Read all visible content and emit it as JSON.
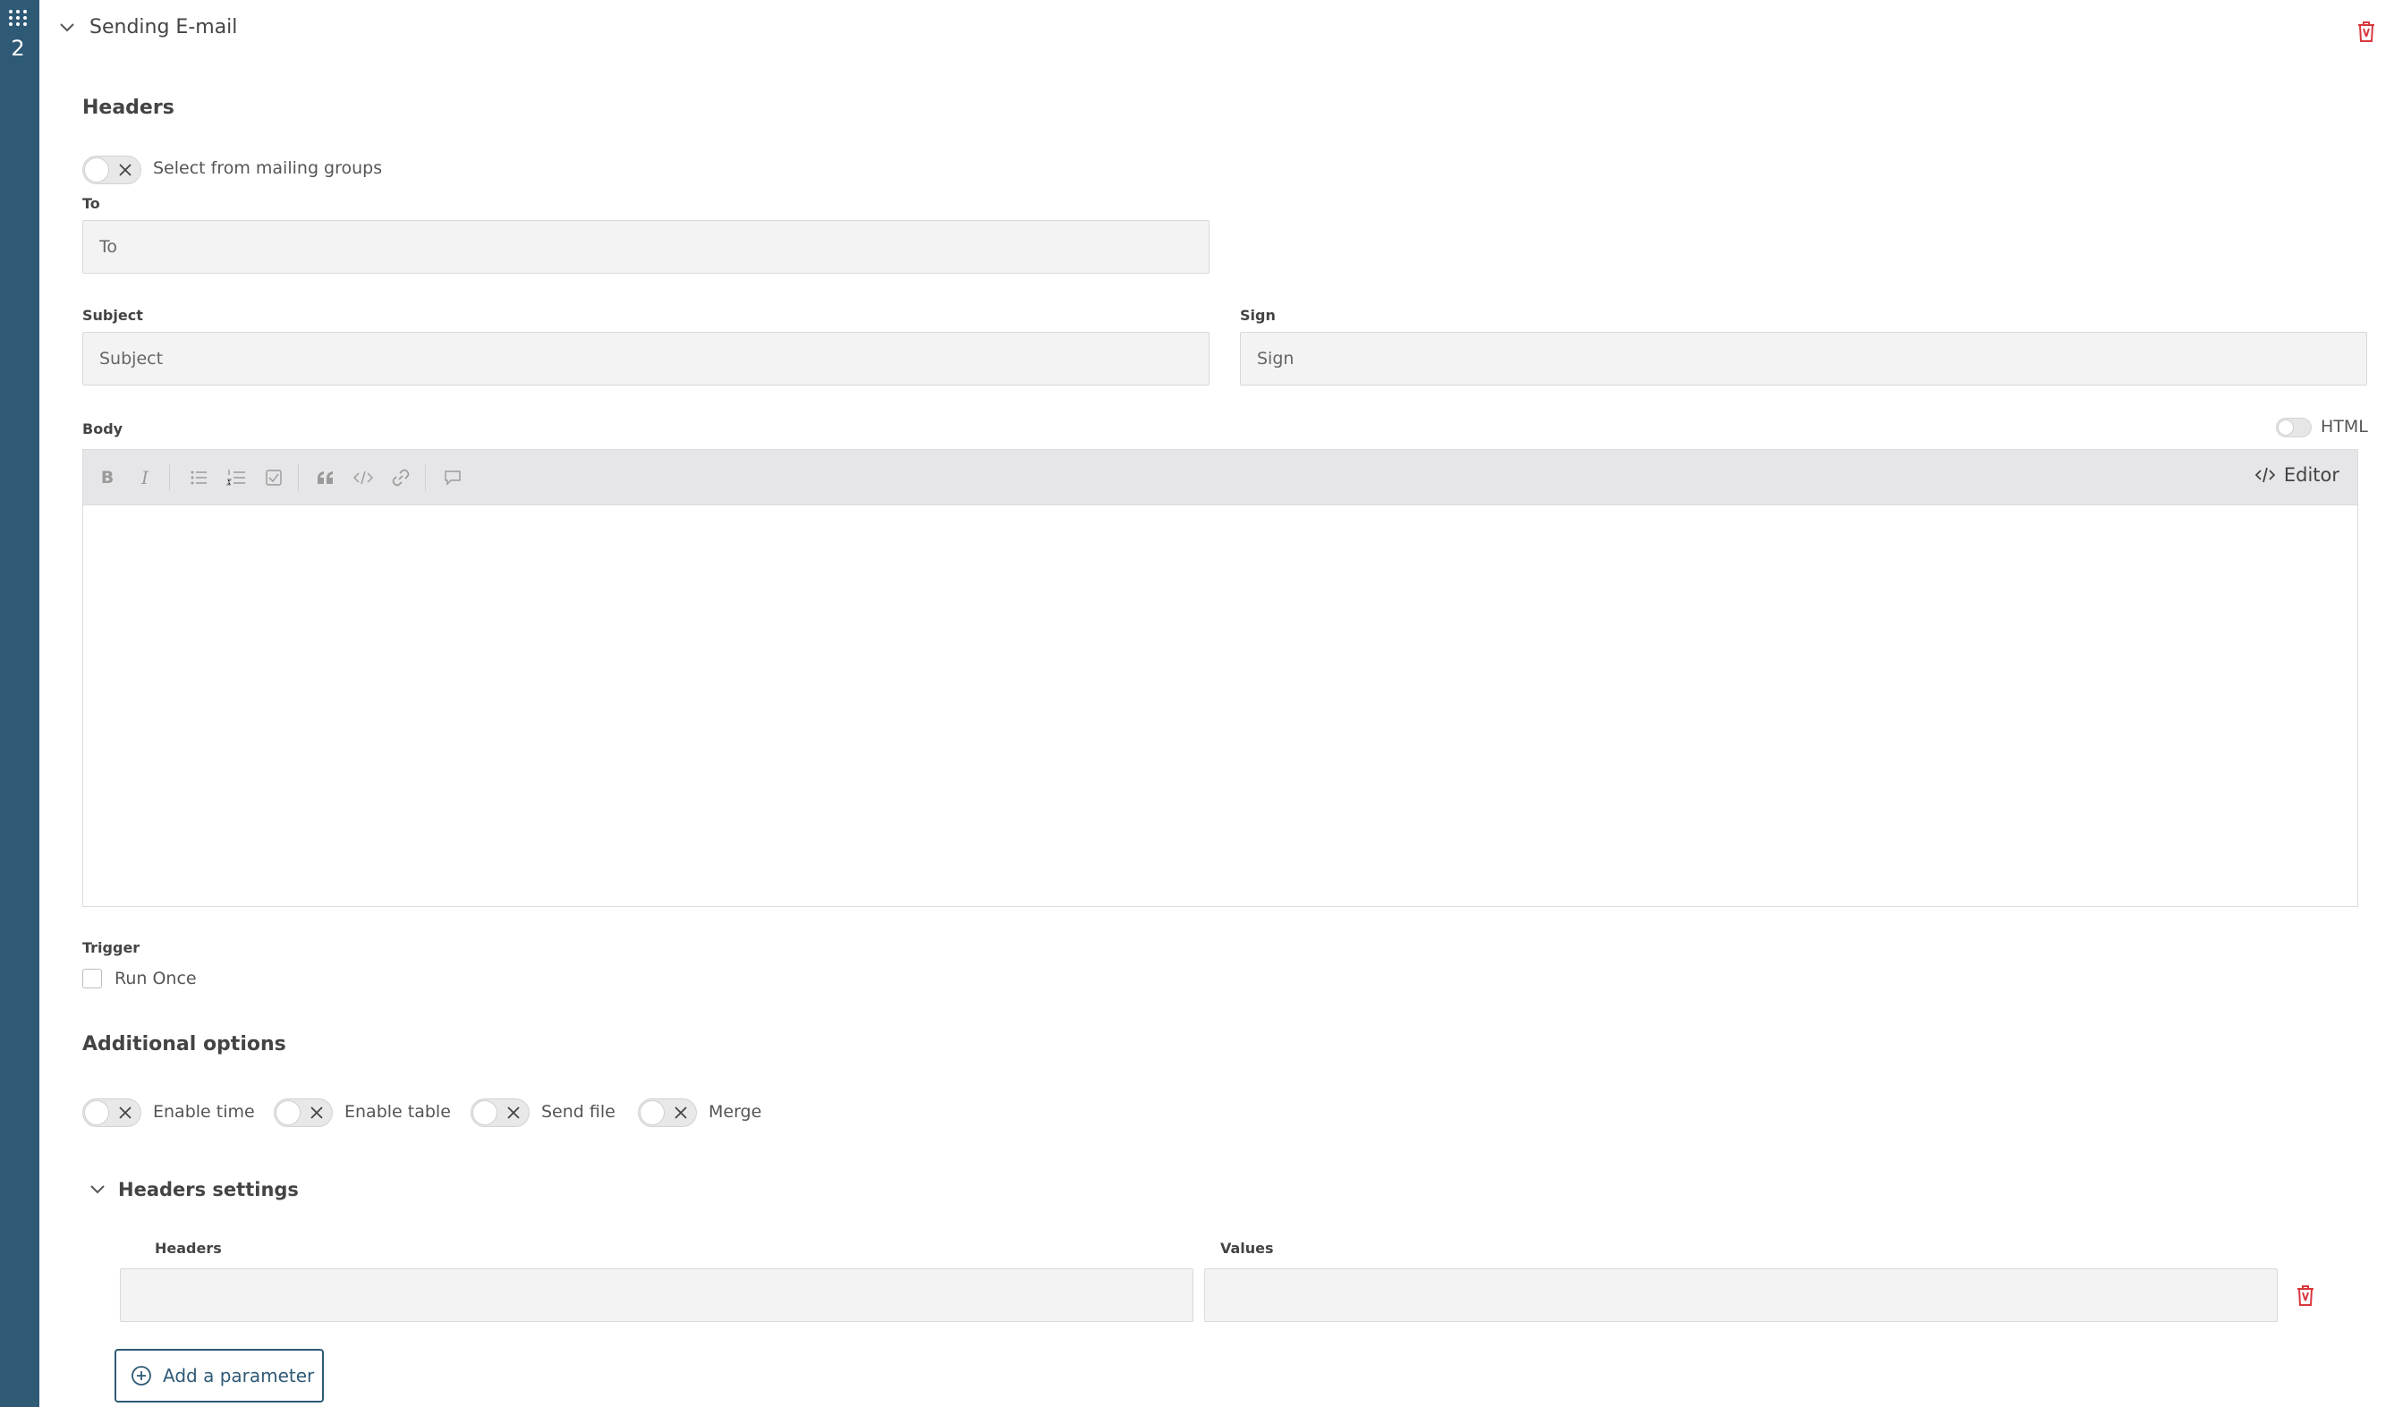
{
  "rail": {
    "step_number": "2"
  },
  "section": {
    "title": "Sending E-mail"
  },
  "headers": {
    "title": "Headers",
    "mailing_toggle_label": "Select from mailing groups",
    "to": {
      "label": "To",
      "placeholder": "To"
    },
    "subject": {
      "label": "Subject",
      "placeholder": "Subject"
    },
    "sign": {
      "label": "Sign",
      "placeholder": "Sign"
    }
  },
  "body": {
    "label": "Body",
    "html_toggle_label": "HTML",
    "toolbar": {
      "bold": "B",
      "italic": "I",
      "mode_label": "Editor"
    }
  },
  "trigger": {
    "label": "Trigger",
    "run_once_label": "Run Once"
  },
  "additional": {
    "title": "Additional options",
    "toggles": [
      "Enable time",
      "Enable table",
      "Send file",
      "Merge"
    ]
  },
  "headers_settings": {
    "title": "Headers settings",
    "col_headers": "Headers",
    "col_values": "Values",
    "add_button": "Add a parameter"
  },
  "colors": {
    "rail": "#2f5a76",
    "danger": "#d9363e",
    "toolbar_bg": "#e6e6e8",
    "input_bg": "#f3f3f4"
  }
}
